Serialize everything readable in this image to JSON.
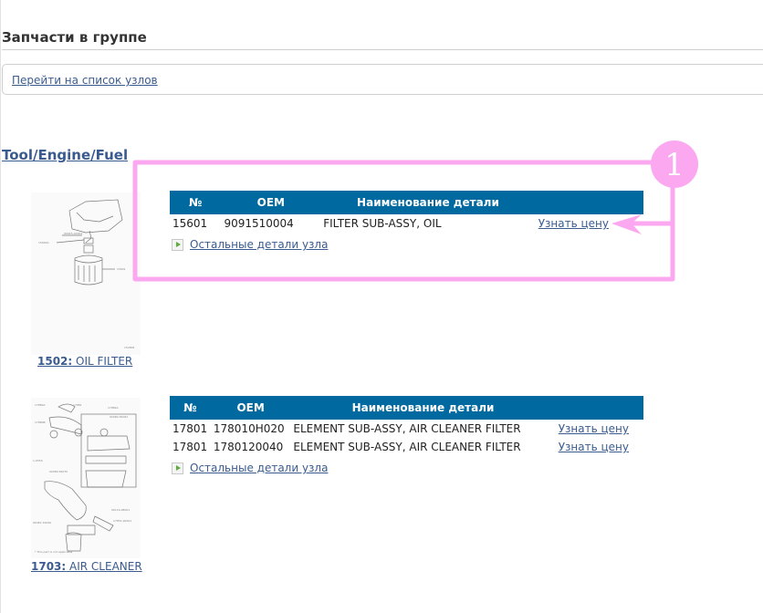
{
  "page": {
    "title": "Запчасти в группе",
    "nav_link": "Перейти на список узлов",
    "group_link": "Tool/Engine/Fuel"
  },
  "table_headers": {
    "num": "№",
    "oem": "OEM",
    "name": "Наименование детали"
  },
  "units": [
    {
      "code": "1502:",
      "name": "OIL FILTER",
      "image_icon": "oil-filter-diagram",
      "parts": [
        {
          "num": "15601",
          "oem": "9091510004",
          "name": "FILTER SUB-ASSY, OIL",
          "action": "Узнать цену"
        }
      ],
      "more_link": "Остальные детали узла"
    },
    {
      "code": "1703:",
      "name": "AIR CLEANER",
      "image_icon": "air-cleaner-diagram",
      "parts": [
        {
          "num": "17801",
          "oem": "178010H020",
          "name": "ELEMENT SUB-ASSY, AIR CLEANER FILTER",
          "action": "Узнать цену"
        },
        {
          "num": "17801",
          "oem": "1780120040",
          "name": "ELEMENT SUB-ASSY, AIR CLEANER FILTER",
          "action": "Узнать цену"
        }
      ],
      "more_link": "Остальные детали узла"
    }
  ],
  "annotation": {
    "badge_number": "1",
    "color": "#fba8f0"
  }
}
